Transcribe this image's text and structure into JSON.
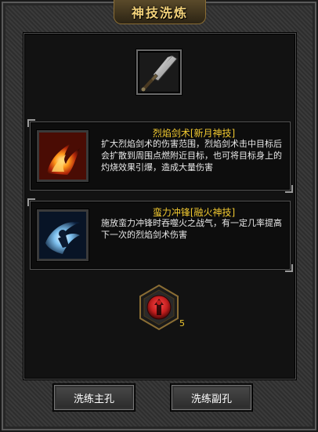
{
  "window": {
    "title": "神技洗炼"
  },
  "weapon_slot": {
    "icon": "broad-sword-icon"
  },
  "skills": [
    {
      "title": "烈焰剑术[新月神技]",
      "description": "扩大烈焰剑术的伤害范围，烈焰剑术击中目标后会扩散到周围点燃附近目标，也可将目标身上的灼烧效果引爆，造成大量伤害",
      "icon": "flame-sword-icon"
    },
    {
      "title": "蛮力冲锋[融火神技]",
      "description": "施放蛮力冲锋时吞噬火之战气，有一定几率提高下一次的烈焰剑术伤害",
      "icon": "charge-warrior-icon"
    }
  ],
  "rune": {
    "icon": "red-rune-icon",
    "count": "5"
  },
  "buttons": {
    "main_hole": "洗练主孔",
    "sub_hole": "洗练副孔"
  },
  "colors": {
    "title": "#f3d27a",
    "skill_title": "#f0c830",
    "rune_red": "#c21e1e"
  }
}
